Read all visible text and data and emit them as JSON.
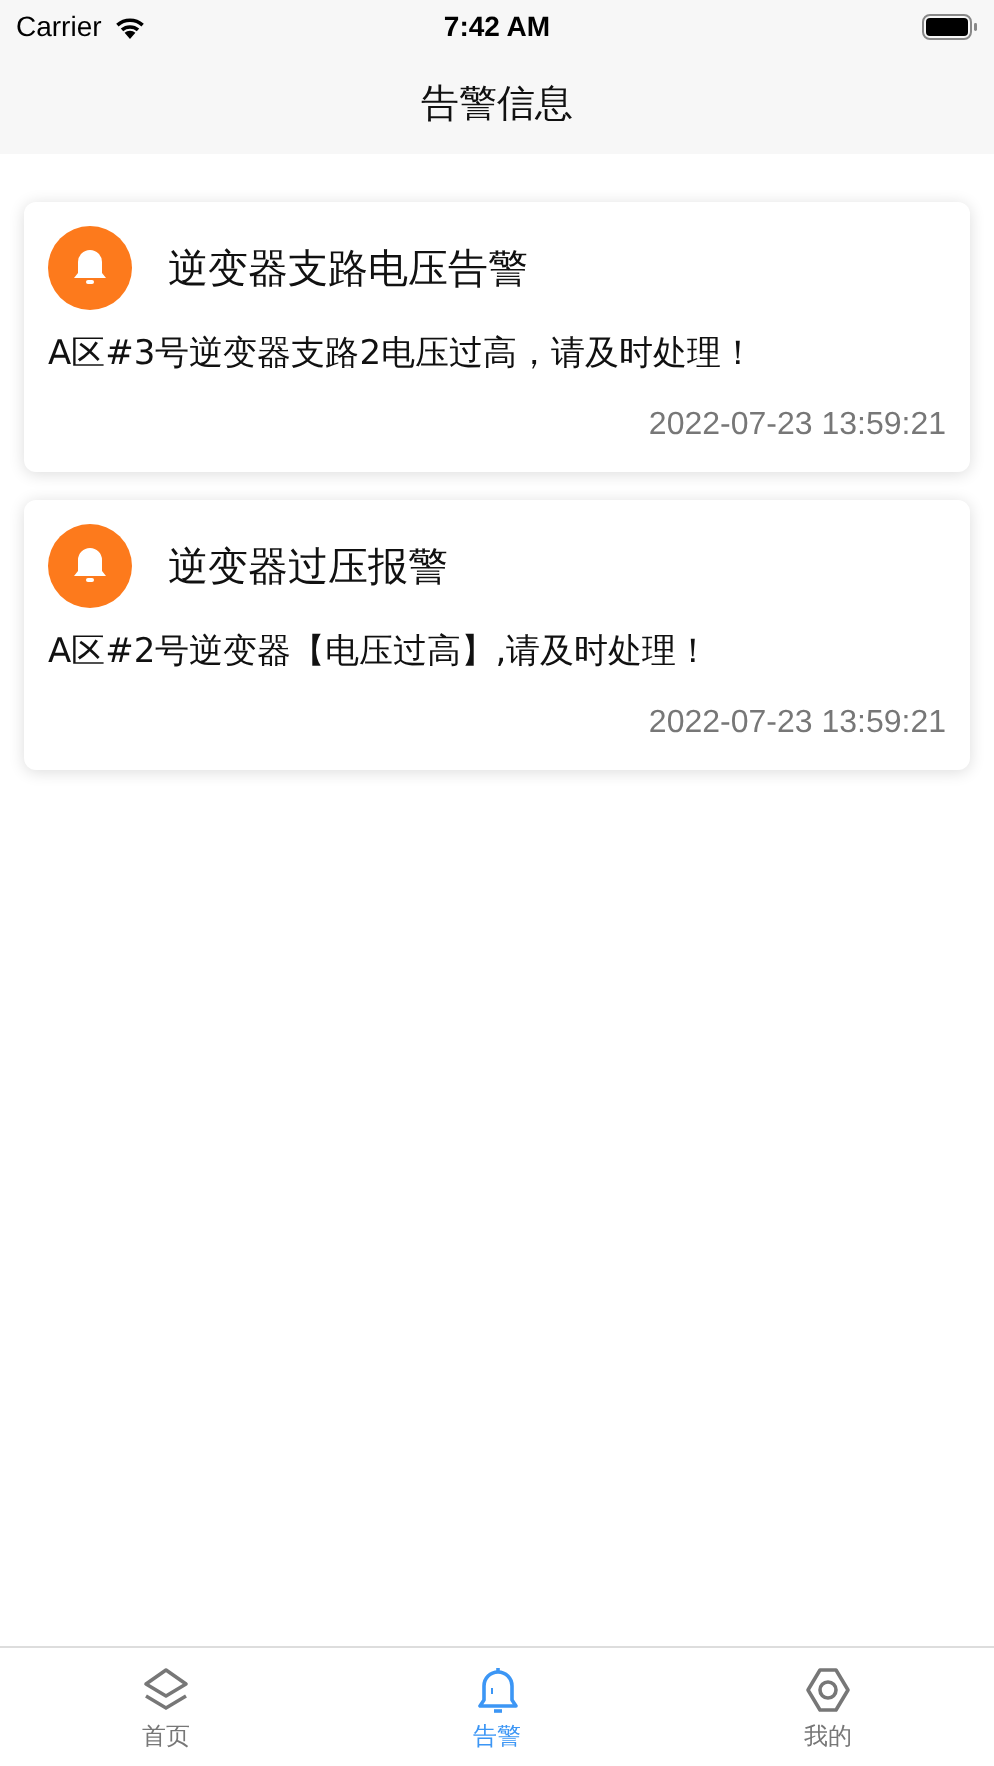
{
  "status_bar": {
    "carrier": "Carrier",
    "time": "7:42 AM"
  },
  "nav": {
    "title": "告警信息"
  },
  "alarms": [
    {
      "title": "逆变器支路电压告警",
      "message": "A区#3号逆变器支路2电压过高，请及时处理！",
      "time": "2022-07-23 13:59:21"
    },
    {
      "title": "逆变器过压报警",
      "message": "A区#2号逆变器【电压过高】,请及时处理！",
      "time": "2022-07-23 13:59:21"
    }
  ],
  "tabs": [
    {
      "kind": "layers",
      "label": "首页",
      "selected": false
    },
    {
      "kind": "bell",
      "label": "告警",
      "selected": true
    },
    {
      "kind": "gear",
      "label": "我的",
      "selected": false
    }
  ]
}
